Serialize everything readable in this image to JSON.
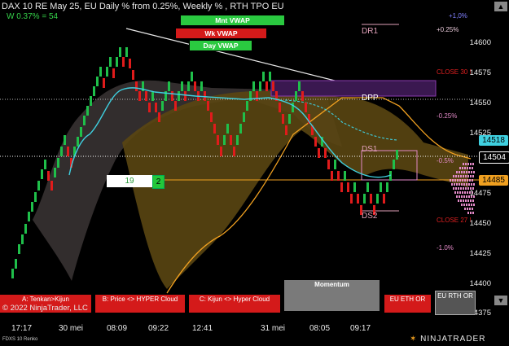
{
  "title": "DAX 10  RE May 25, EU Daily % from 0.25%, Weekly % , RTH TPO EU",
  "w_value": "W 0.37% = 54",
  "vwap_buttons": {
    "mnt": "Mnt VWAP",
    "wk": "Wk VWAP",
    "day": "Day VWAP"
  },
  "y_ticks": [
    "14600",
    "14575",
    "14550",
    "14525",
    "14475",
    "14450",
    "14425",
    "14400",
    "14375"
  ],
  "price_boxes": {
    "cyan": "14518",
    "white": "14504",
    "orange": "14485"
  },
  "pct_labels": {
    "p1": "+1,0%",
    "p025": "+0.25%",
    "close30": "CLOSE 30 !",
    "m025": "-0.25%",
    "m05": "-0.5%",
    "close27": "CLOSE 27 !",
    "m10": "-1.0%"
  },
  "levels": {
    "dr1": "DR1",
    "dpp": "DPP",
    "ds1": "DS1",
    "ds2": "DS2"
  },
  "counter": {
    "left": "19",
    "right": "2"
  },
  "bottom_buttons": {
    "a": "A: Tenkan>Kijun",
    "b": "B: Price <> HYPER Cloud",
    "c": "C: Kijun <> Hyper Cloud",
    "momentum": "Momentum",
    "eu_eth": "EU ETH OR",
    "eu_rth": "EU RTH OR"
  },
  "copyright": "© 2022 NinjaTrader, LLC",
  "x_ticks": [
    "17:17",
    "30 mei",
    "08:09",
    "09:22",
    "12:41",
    "31 mei",
    "08:05",
    "09:17"
  ],
  "footer_left": "FDXS 10 Renko",
  "logo": "NINJATRADER",
  "colors": {
    "up": "#1fbf4a",
    "down": "#e01b1b",
    "cyan": "#3fd0e0",
    "cloud": "#6a5210",
    "orange": "#f0a020",
    "pink": "#e38ac8",
    "purple": "#3a1850"
  }
}
